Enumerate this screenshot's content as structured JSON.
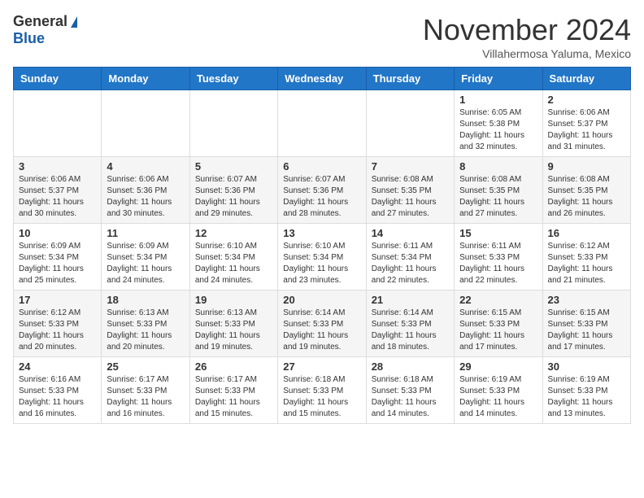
{
  "header": {
    "logo_general": "General",
    "logo_blue": "Blue",
    "month_title": "November 2024",
    "location": "Villahermosa Yaluma, Mexico"
  },
  "weekdays": [
    "Sunday",
    "Monday",
    "Tuesday",
    "Wednesday",
    "Thursday",
    "Friday",
    "Saturday"
  ],
  "weeks": [
    [
      {
        "day": "",
        "info": ""
      },
      {
        "day": "",
        "info": ""
      },
      {
        "day": "",
        "info": ""
      },
      {
        "day": "",
        "info": ""
      },
      {
        "day": "",
        "info": ""
      },
      {
        "day": "1",
        "info": "Sunrise: 6:05 AM\nSunset: 5:38 PM\nDaylight: 11 hours and 32 minutes."
      },
      {
        "day": "2",
        "info": "Sunrise: 6:06 AM\nSunset: 5:37 PM\nDaylight: 11 hours and 31 minutes."
      }
    ],
    [
      {
        "day": "3",
        "info": "Sunrise: 6:06 AM\nSunset: 5:37 PM\nDaylight: 11 hours and 30 minutes."
      },
      {
        "day": "4",
        "info": "Sunrise: 6:06 AM\nSunset: 5:36 PM\nDaylight: 11 hours and 30 minutes."
      },
      {
        "day": "5",
        "info": "Sunrise: 6:07 AM\nSunset: 5:36 PM\nDaylight: 11 hours and 29 minutes."
      },
      {
        "day": "6",
        "info": "Sunrise: 6:07 AM\nSunset: 5:36 PM\nDaylight: 11 hours and 28 minutes."
      },
      {
        "day": "7",
        "info": "Sunrise: 6:08 AM\nSunset: 5:35 PM\nDaylight: 11 hours and 27 minutes."
      },
      {
        "day": "8",
        "info": "Sunrise: 6:08 AM\nSunset: 5:35 PM\nDaylight: 11 hours and 27 minutes."
      },
      {
        "day": "9",
        "info": "Sunrise: 6:08 AM\nSunset: 5:35 PM\nDaylight: 11 hours and 26 minutes."
      }
    ],
    [
      {
        "day": "10",
        "info": "Sunrise: 6:09 AM\nSunset: 5:34 PM\nDaylight: 11 hours and 25 minutes."
      },
      {
        "day": "11",
        "info": "Sunrise: 6:09 AM\nSunset: 5:34 PM\nDaylight: 11 hours and 24 minutes."
      },
      {
        "day": "12",
        "info": "Sunrise: 6:10 AM\nSunset: 5:34 PM\nDaylight: 11 hours and 24 minutes."
      },
      {
        "day": "13",
        "info": "Sunrise: 6:10 AM\nSunset: 5:34 PM\nDaylight: 11 hours and 23 minutes."
      },
      {
        "day": "14",
        "info": "Sunrise: 6:11 AM\nSunset: 5:34 PM\nDaylight: 11 hours and 22 minutes."
      },
      {
        "day": "15",
        "info": "Sunrise: 6:11 AM\nSunset: 5:33 PM\nDaylight: 11 hours and 22 minutes."
      },
      {
        "day": "16",
        "info": "Sunrise: 6:12 AM\nSunset: 5:33 PM\nDaylight: 11 hours and 21 minutes."
      }
    ],
    [
      {
        "day": "17",
        "info": "Sunrise: 6:12 AM\nSunset: 5:33 PM\nDaylight: 11 hours and 20 minutes."
      },
      {
        "day": "18",
        "info": "Sunrise: 6:13 AM\nSunset: 5:33 PM\nDaylight: 11 hours and 20 minutes."
      },
      {
        "day": "19",
        "info": "Sunrise: 6:13 AM\nSunset: 5:33 PM\nDaylight: 11 hours and 19 minutes."
      },
      {
        "day": "20",
        "info": "Sunrise: 6:14 AM\nSunset: 5:33 PM\nDaylight: 11 hours and 19 minutes."
      },
      {
        "day": "21",
        "info": "Sunrise: 6:14 AM\nSunset: 5:33 PM\nDaylight: 11 hours and 18 minutes."
      },
      {
        "day": "22",
        "info": "Sunrise: 6:15 AM\nSunset: 5:33 PM\nDaylight: 11 hours and 17 minutes."
      },
      {
        "day": "23",
        "info": "Sunrise: 6:15 AM\nSunset: 5:33 PM\nDaylight: 11 hours and 17 minutes."
      }
    ],
    [
      {
        "day": "24",
        "info": "Sunrise: 6:16 AM\nSunset: 5:33 PM\nDaylight: 11 hours and 16 minutes."
      },
      {
        "day": "25",
        "info": "Sunrise: 6:17 AM\nSunset: 5:33 PM\nDaylight: 11 hours and 16 minutes."
      },
      {
        "day": "26",
        "info": "Sunrise: 6:17 AM\nSunset: 5:33 PM\nDaylight: 11 hours and 15 minutes."
      },
      {
        "day": "27",
        "info": "Sunrise: 6:18 AM\nSunset: 5:33 PM\nDaylight: 11 hours and 15 minutes."
      },
      {
        "day": "28",
        "info": "Sunrise: 6:18 AM\nSunset: 5:33 PM\nDaylight: 11 hours and 14 minutes."
      },
      {
        "day": "29",
        "info": "Sunrise: 6:19 AM\nSunset: 5:33 PM\nDaylight: 11 hours and 14 minutes."
      },
      {
        "day": "30",
        "info": "Sunrise: 6:19 AM\nSunset: 5:33 PM\nDaylight: 11 hours and 13 minutes."
      }
    ]
  ]
}
